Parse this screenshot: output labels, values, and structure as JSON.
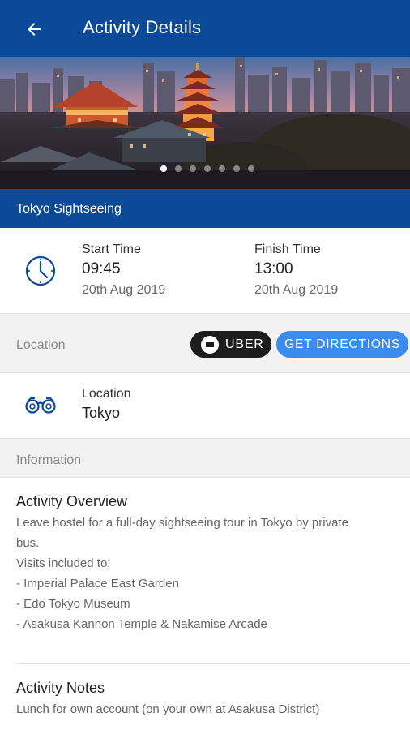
{
  "appbar": {
    "title": "Activity Details",
    "back_icon": "arrow-left-icon"
  },
  "hero": {
    "slides_count": 7,
    "active_slide": 0
  },
  "activity": {
    "name": "Tokyo Sightseeing"
  },
  "time": {
    "icon": "clock-icon",
    "start_label": "Start Time",
    "start_time": "09:45",
    "start_date": "20th Aug 2019",
    "finish_label": "Finish Time",
    "finish_time": "13:00",
    "finish_date": "20th Aug 2019"
  },
  "location_section": {
    "header": "Location",
    "uber_label": "UBER",
    "directions_label": "GET DIRECTIONS",
    "icon": "binoculars-icon",
    "label": "Location",
    "value": "Tokyo"
  },
  "information": {
    "header": "Information",
    "overview_title": "Activity Overview",
    "overview_lines": [
      "Leave hostel for a full-day sightseeing tour in Tokyo by private",
      "bus.",
      "Visits included to:",
      "- Imperial Palace East Garden",
      "- Edo Tokyo Museum",
      "- Asakusa Kannon Temple & Nakamise Arcade"
    ],
    "notes_title": "Activity Notes",
    "notes_text": "Lunch for own account (on your own at Asakusa District)"
  },
  "colors": {
    "primary": "#0b4a98",
    "accent": "#3b8cf0",
    "uber": "#1d1d1d",
    "section_bg": "#f2f2f2"
  }
}
